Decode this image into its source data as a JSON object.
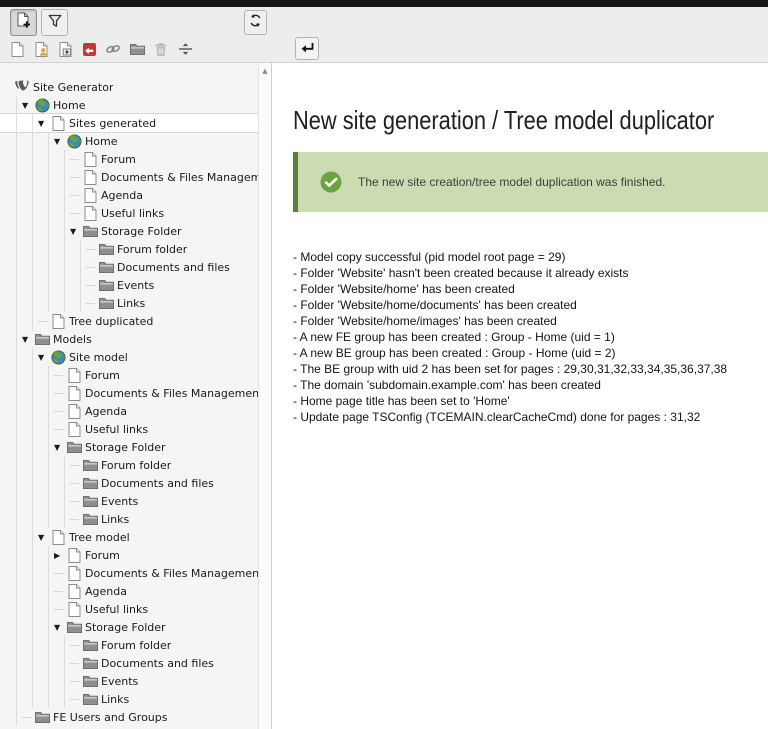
{
  "toolbar": {
    "buttons": [
      {
        "id": "new-page-toggle",
        "icon": "new-page",
        "active": true
      },
      {
        "id": "filter",
        "icon": "filter",
        "active": false
      },
      {
        "id": "refresh",
        "icon": "refresh",
        "active": false
      },
      {
        "id": "return",
        "icon": "return",
        "active": false
      }
    ],
    "drag_icons": [
      "page",
      "shortcut-page",
      "mountpoint-page",
      "external-url-page",
      "link",
      "folder",
      "trash",
      "divider"
    ]
  },
  "tree": {
    "items": [
      {
        "level": 0,
        "icon": "typo3-logo",
        "label": "Site Generator",
        "expand": "none",
        "selected": false
      },
      {
        "level": 1,
        "icon": "globe",
        "label": "Home",
        "expand": "open",
        "selected": false
      },
      {
        "level": 2,
        "icon": "page",
        "label": "Sites generated",
        "expand": "open",
        "selected": true
      },
      {
        "level": 3,
        "icon": "globe",
        "label": "Home",
        "expand": "open",
        "selected": false
      },
      {
        "level": 4,
        "icon": "page",
        "label": "Forum",
        "expand": "none",
        "selected": false
      },
      {
        "level": 4,
        "icon": "page",
        "label": "Documents & Files Management",
        "expand": "none",
        "selected": false
      },
      {
        "level": 4,
        "icon": "page",
        "label": "Agenda",
        "expand": "none",
        "selected": false
      },
      {
        "level": 4,
        "icon": "page",
        "label": "Useful links",
        "expand": "none",
        "selected": false
      },
      {
        "level": 4,
        "icon": "folder",
        "label": "Storage Folder",
        "expand": "open",
        "selected": false
      },
      {
        "level": 5,
        "icon": "folder",
        "label": "Forum folder",
        "expand": "none",
        "selected": false
      },
      {
        "level": 5,
        "icon": "folder",
        "label": "Documents and files",
        "expand": "none",
        "selected": false
      },
      {
        "level": 5,
        "icon": "folder",
        "label": "Events",
        "expand": "none",
        "selected": false
      },
      {
        "level": 5,
        "icon": "folder",
        "label": "Links",
        "expand": "none",
        "selected": false
      },
      {
        "level": 2,
        "icon": "page",
        "label": "Tree duplicated",
        "expand": "none",
        "selected": false
      },
      {
        "level": 1,
        "icon": "folder",
        "label": "Models",
        "expand": "open",
        "selected": false
      },
      {
        "level": 2,
        "icon": "globe",
        "label": "Site model",
        "expand": "open",
        "selected": false
      },
      {
        "level": 3,
        "icon": "page",
        "label": "Forum",
        "expand": "none",
        "selected": false
      },
      {
        "level": 3,
        "icon": "page",
        "label": "Documents & Files Management",
        "expand": "none",
        "selected": false
      },
      {
        "level": 3,
        "icon": "page",
        "label": "Agenda",
        "expand": "none",
        "selected": false
      },
      {
        "level": 3,
        "icon": "page",
        "label": "Useful links",
        "expand": "none",
        "selected": false
      },
      {
        "level": 3,
        "icon": "folder",
        "label": "Storage Folder",
        "expand": "open",
        "selected": false
      },
      {
        "level": 4,
        "icon": "folder",
        "label": "Forum folder",
        "expand": "none",
        "selected": false
      },
      {
        "level": 4,
        "icon": "folder",
        "label": "Documents and files",
        "expand": "none",
        "selected": false
      },
      {
        "level": 4,
        "icon": "folder",
        "label": "Events",
        "expand": "none",
        "selected": false
      },
      {
        "level": 4,
        "icon": "folder",
        "label": "Links",
        "expand": "none",
        "selected": false
      },
      {
        "level": 2,
        "icon": "page",
        "label": "Tree model",
        "expand": "open",
        "selected": false
      },
      {
        "level": 3,
        "icon": "page",
        "label": "Forum",
        "expand": "closed",
        "selected": false
      },
      {
        "level": 3,
        "icon": "page",
        "label": "Documents & Files Management",
        "expand": "none",
        "selected": false
      },
      {
        "level": 3,
        "icon": "page",
        "label": "Agenda",
        "expand": "none",
        "selected": false
      },
      {
        "level": 3,
        "icon": "page",
        "label": "Useful links",
        "expand": "none",
        "selected": false
      },
      {
        "level": 3,
        "icon": "folder",
        "label": "Storage Folder",
        "expand": "open",
        "selected": false
      },
      {
        "level": 4,
        "icon": "folder",
        "label": "Forum folder",
        "expand": "none",
        "selected": false
      },
      {
        "level": 4,
        "icon": "folder",
        "label": "Documents and files",
        "expand": "none",
        "selected": false
      },
      {
        "level": 4,
        "icon": "folder",
        "label": "Events",
        "expand": "none",
        "selected": false
      },
      {
        "level": 4,
        "icon": "folder",
        "label": "Links",
        "expand": "none",
        "selected": false
      },
      {
        "level": 1,
        "icon": "folder",
        "label": "FE Users and Groups",
        "expand": "none",
        "selected": false
      }
    ]
  },
  "content": {
    "title": "New site generation / Tree model duplicator",
    "alert": {
      "type": "success",
      "icon": "check-circle",
      "message": "The new site creation/tree model duplication was finished."
    },
    "log_lines": [
      "- Model copy successful (pid model root page = 29)",
      "- Folder 'Website' hasn't been created because it already exists",
      "- Folder 'Website/home' has been created",
      "- Folder 'Website/home/documents' has been created",
      "- Folder 'Website/home/images' has been created",
      "- A new FE group has been created : Group - Home (uid = 1)",
      "- A new BE group has been created : Group - Home (uid = 2)",
      "- The BE group with uid 2 has been set for pages : 29,30,31,32,33,34,35,36,37,38",
      "- The domain 'subdomain.example.com' has been created",
      "- Home page title has been set to 'Home'",
      "- Update page TSConfig (TCEMAIN.clearCacheCmd) done for pages : 31,32"
    ]
  },
  "colors": {
    "topbar": "#161616",
    "toolbar_bg": "#ededed",
    "tree_bg": "#f5f5f5",
    "selection_bg": "#ffffff",
    "success_bg": "#ccdcb2",
    "success_border": "#5e7f3c",
    "success_icon_circle": "#69a342"
  }
}
